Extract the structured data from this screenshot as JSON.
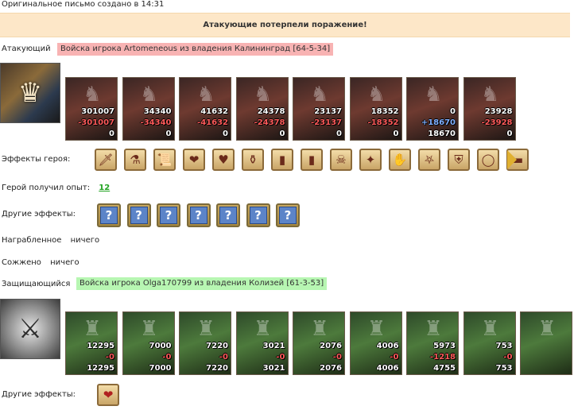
{
  "header": {
    "created_text": "Оригинальное письмо создано в 14:31"
  },
  "result": {
    "text": "Атакующие потерпели поражение!"
  },
  "attacker": {
    "label": "Атакующий",
    "army_title": "Войска игрока Artomeneous из владения Калининград [64-5-34]",
    "units": [
      {
        "count": "301007",
        "loss": "-301007",
        "left": "0"
      },
      {
        "count": "34340",
        "loss": "-34340",
        "left": "0"
      },
      {
        "count": "41632",
        "loss": "-41632",
        "left": "0"
      },
      {
        "count": "24378",
        "loss": "-24378",
        "left": "0"
      },
      {
        "count": "23137",
        "loss": "-23137",
        "left": "0"
      },
      {
        "count": "18352",
        "loss": "-18352",
        "left": "0"
      },
      {
        "count": "0",
        "loss": "+18670",
        "left": "18670"
      },
      {
        "count": "23928",
        "loss": "-23928",
        "left": "0"
      }
    ],
    "hero_effects_label": "Эффекты героя:",
    "hero_effects_icons": [
      "sword-icon",
      "potion-icon",
      "scroll-icon",
      "heart-icon",
      "heart-sword-icon",
      "flask-icon",
      "door-icon",
      "door-icon",
      "skull-icon",
      "wand-icon",
      "hand-icon",
      "pentagram-icon",
      "armor-icon",
      "ring-icon",
      "ruler-icon"
    ],
    "exp_label": "Герой получил опыт:",
    "exp_value": "12",
    "other_effects_label": "Другие эффекты:",
    "other_effects_count": 7,
    "loot_label": "Награбленное",
    "loot_value": "ничего",
    "burned_label": "Сожжено",
    "burned_value": "ничего"
  },
  "defender": {
    "label": "Защищающийся",
    "army_title": "Войска игрока Olga170799 из владения Колизей [61-3-53]",
    "units": [
      {
        "count": "12295",
        "loss": "-0",
        "left": "12295"
      },
      {
        "count": "7000",
        "loss": "-0",
        "left": "7000"
      },
      {
        "count": "7220",
        "loss": "-0",
        "left": "7220"
      },
      {
        "count": "3021",
        "loss": "-0",
        "left": "3021"
      },
      {
        "count": "2076",
        "loss": "-0",
        "left": "2076"
      },
      {
        "count": "4006",
        "loss": "-0",
        "left": "4006"
      },
      {
        "count": "5973",
        "loss": "-1218",
        "left": "4755"
      },
      {
        "count": "753",
        "loss": "-0",
        "left": "753"
      },
      {
        "count": "",
        "loss": "",
        "left": ""
      }
    ],
    "other_effects_label": "Другие эффекты:"
  },
  "colors": {
    "attacker_tag": "#f8b3b3",
    "defender_tag": "#b7f6b2",
    "result_bar": "#fde7c8",
    "exp": "#21a321"
  }
}
